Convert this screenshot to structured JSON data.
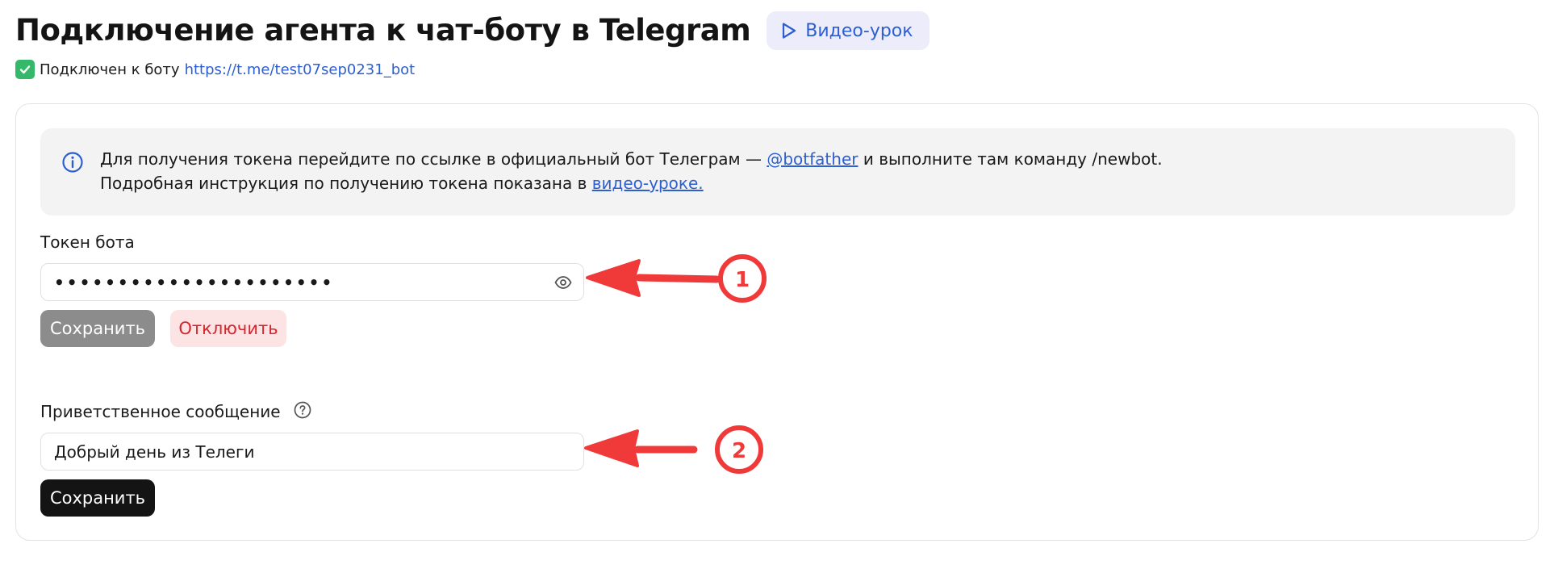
{
  "header": {
    "title": "Подключение агента к чат-боту в Telegram",
    "video_button_label": "Видео-урок"
  },
  "status": {
    "connected_text": "Подключен к боту",
    "bot_link": "https://t.me/test07sep0231_bot"
  },
  "info": {
    "line1_before": "Для получения токена перейдите по ссылке в официальный бот Телеграм — ",
    "line1_link": "@botfather",
    "line1_after": " и выполните там команду /newbot.",
    "line2_before": "Подробная инструкция по получению токена показана в ",
    "line2_link": "видео-уроке."
  },
  "token_section": {
    "label": "Токен бота",
    "masked_value": "••••••••••••••••••••••",
    "save_label": "Сохранить",
    "disconnect_label": "Отключить"
  },
  "greeting_section": {
    "label": "Приветственное сообщение",
    "value": "Добрый день из Телеги",
    "save_label": "Сохранить"
  },
  "annotations": {
    "badge_1": "1",
    "badge_2": "2"
  },
  "colors": {
    "accent_blue": "#2c5fd1",
    "success_green": "#35b86a",
    "danger_red": "#d9232b",
    "annotation_red": "#f03a3a"
  },
  "icons": {
    "video_button": "play-icon",
    "status": "check-icon",
    "info": "info-icon",
    "password_toggle": "eye-icon",
    "help": "help-icon"
  }
}
